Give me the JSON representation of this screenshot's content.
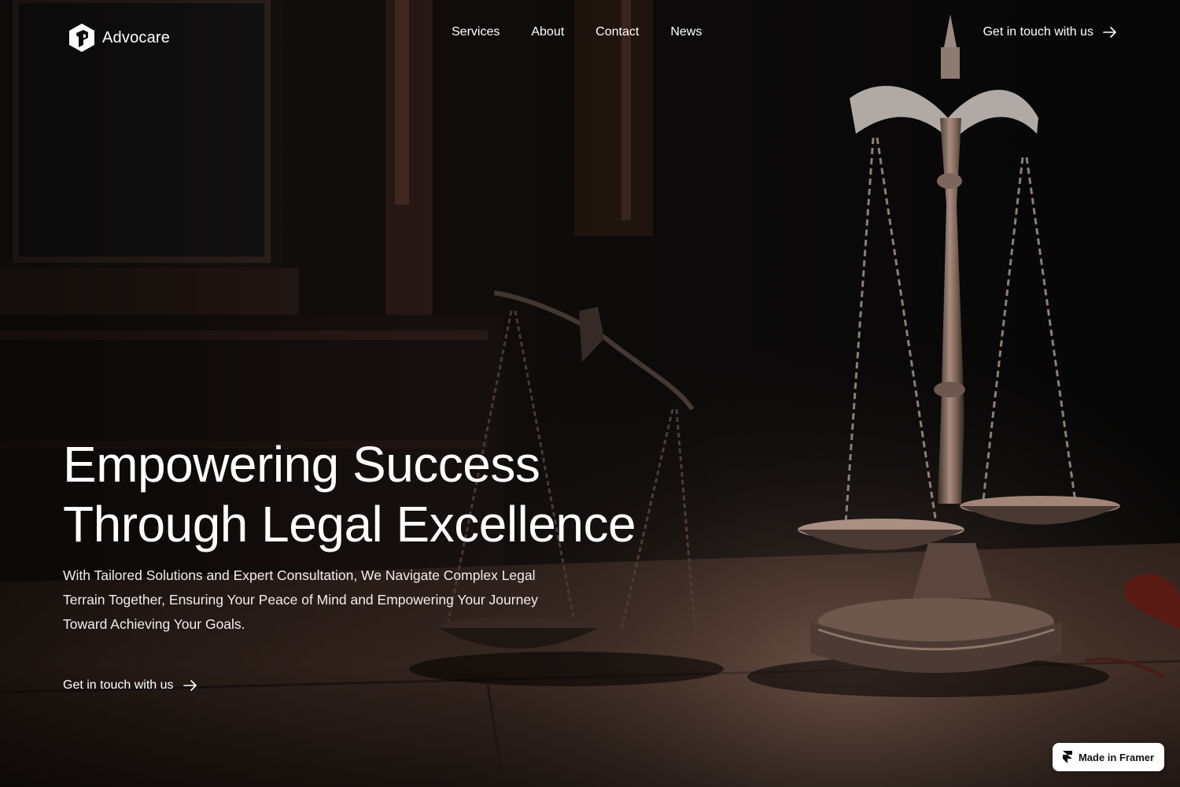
{
  "brand": {
    "name": "Advocare",
    "logo_icon": "cube-shield-icon"
  },
  "nav": {
    "items": [
      "Services",
      "About",
      "Contact",
      "News"
    ],
    "cta_label": "Get in touch with us",
    "cta_icon": "arrow-right-icon"
  },
  "hero": {
    "headline_line1": "Empowering Success",
    "headline_line2": "Through Legal Excellence",
    "lead": "With Tailored Solutions and Expert Consultation, We Navigate Complex Legal Terrain Together, Ensuring Your Peace of Mind and Empowering Your Journey Toward Achieving Your Goals.",
    "cta_label": "Get in touch with us",
    "image_subject": "scales-of-justice"
  },
  "badge": {
    "label": "Made in Framer",
    "icon": "framer-icon"
  },
  "colors": {
    "background": "#0a0808",
    "text": "#ffffff",
    "wood": "#5a3b30",
    "brass": "#9a8070"
  }
}
